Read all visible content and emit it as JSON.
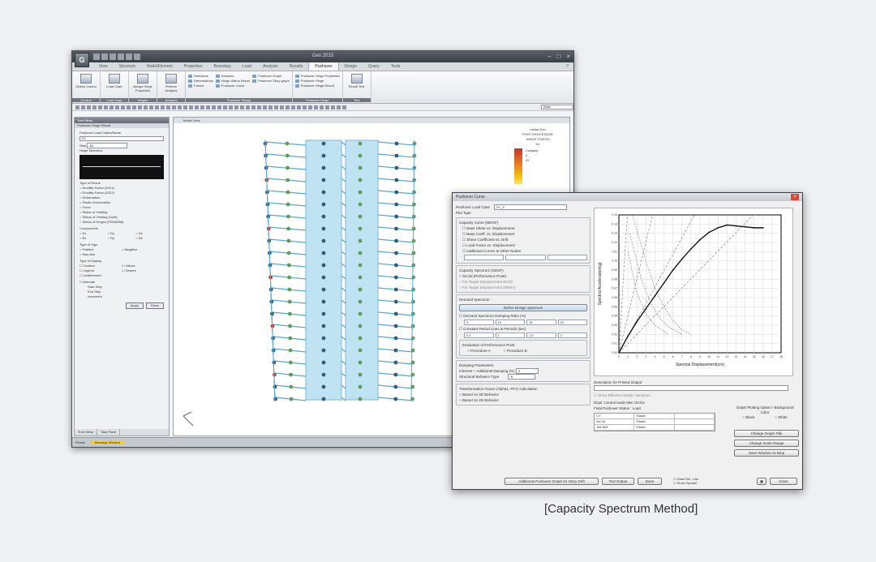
{
  "app": {
    "logo": "G",
    "title": "Gen 2015",
    "tabs": [
      "View",
      "Structure",
      "Node/Element",
      "Properties",
      "Boundary",
      "Load",
      "Analysis",
      "Results",
      "Pushover",
      "Design",
      "Query",
      "Tools"
    ],
    "active_tab": "Pushover",
    "ribbon": {
      "groups": [
        {
          "label": "Control",
          "buttons": [
            "Global Control"
          ]
        },
        {
          "label": "Load Case",
          "buttons": [
            "Load Case"
          ]
        },
        {
          "label": "Hinges",
          "buttons": [
            "Assign Hinge Properties"
          ]
        },
        {
          "label": "Analysis",
          "buttons": [
            "Perform Analysis"
          ]
        },
        {
          "label": "Pushover Result",
          "items": [
            "Reactions",
            "Deformations",
            "Forces",
            "Stresses",
            "Hinge Status Result",
            "Pushover Curve",
            "Pushover Graph",
            "Pushover Story graph"
          ]
        },
        {
          "label": "Pushover Hinge",
          "items": [
            "Pushover Hinge Properties",
            "Pushover Hinge",
            "Pushover Hinge Result"
          ]
        },
        {
          "label": "Text",
          "buttons": [
            "Result Text"
          ]
        }
      ]
    },
    "toolbar_search": "Base",
    "viewport_tab": "Model View",
    "legend": {
      "lines": [
        "midas Gen",
        "POST-PROCESSOR",
        "HINGE STATUS",
        "Dx"
      ],
      "items": [
        "Collapse",
        "0",
        "IO"
      ]
    },
    "status": {
      "left": "Ready",
      "message": "Message Window",
      "mid": "None",
      "units": "kN",
      "scale": "m"
    }
  },
  "tree_panel": {
    "title": "Tree Menu",
    "subtitle": "Pushover Hinge Result",
    "load_case_label": "Pushover Load Cases/Name",
    "load_case_value": "PL",
    "step_label": "Step",
    "step_value": "All",
    "hinge_label": "Hinge Members",
    "type_label": "Type of Result",
    "result_types": [
      "Ductility Factor (D/D1)",
      "Ductility Factor (D/D2)",
      "Deformation",
      "Plastic Deformation",
      "Force",
      "Status of Yielding",
      "Status of Yielding (Limit)",
      "Status of Hinges (FEMA356)"
    ],
    "components_label": "Components",
    "components": [
      "Dx",
      "Dy",
      "Dz",
      "Rx",
      "Ry",
      "Rz"
    ],
    "sign_label": "Type of Sign",
    "signs": [
      "Positive",
      "Negative",
      "Max Abs"
    ],
    "display_label": "Type of Display",
    "display_opts": [
      "Contour",
      "Values",
      "Legend",
      "Deform",
      "Undeformed"
    ],
    "anim_label": "Animate",
    "start_step": "Start Step",
    "end_step": "End Step",
    "increment": "Increment",
    "apply": "Apply",
    "close": "Close",
    "footer_tabs": [
      "Tree Menu",
      "Task Pane"
    ]
  },
  "dialog": {
    "title": "Pushover Curve",
    "load_case_label": "Pushover Load Case",
    "load_case_value": "PL_X",
    "plot_type": "Plot Type",
    "mdof_header": "Capacity Curve (MDOF)",
    "mdof_opts": [
      "Base Shear vs. Displacement",
      "Base Coeff. vs. Displacement",
      "Shear Coefficient vs. Drift",
      "Load Factor vs. Displacement",
      "Additional Curves at Other Nodes"
    ],
    "sdof_header": "Capacity Spectrum (SDOF)",
    "sdof_opts": [
      "Sa-Sd (Performance Point)",
      "For Target Displacement (EC8)",
      "For Target Displacement (FEMA)"
    ],
    "demand_header": "Demand Spectrum",
    "define_button": "Define Design Spectrum",
    "damping_label": "Demand Spectrum Damping Ratio (%)",
    "damping_values": [
      "5",
      "10",
      "15",
      "20"
    ],
    "period_label": "Constant Period Lines at Periods (sec)",
    "period_values": [
      "0.5",
      "1",
      "1.5",
      "2"
    ],
    "eval_label": "Evaluation of Performance Point",
    "eval_opts": [
      "Procedure A",
      "Procedure B"
    ],
    "damping_params": "Damping Parameters",
    "inherent_label": "Inherent + Additional Damping (%)",
    "inherent_value": "5",
    "structural_label": "Structural Behavior Type",
    "structural_value": "B",
    "transform_label": "Transformation Factor (Alpha1, PF1) Calculation",
    "transform_opts": [
      "Based on 3D Behavior",
      "Based on 2D Behavior"
    ],
    "plot_title": "",
    "desc_label": "Description for Printed Output",
    "perf_point_label": "Show Effective Elastic Spectrum",
    "graph_bg_label": "Graph Plotting Option / Background Color",
    "bg_opts": [
      "Black",
      "White"
    ],
    "ctrl_text": "Displ. Control Node 568, Dir:Dx",
    "ctrl_text2": "Final Pushover Status : Load",
    "table": [
      [
        "V,T",
        "Elastic"
      ],
      [
        "Sa,Sd",
        "Elastic"
      ],
      [
        "Teff,Beff",
        "Elastic"
      ]
    ],
    "side_buttons": [
      "Change Graph Title",
      "Change Scale Range",
      "Save Window As Bmp"
    ],
    "footer_buttons": [
      "Additional Pushover Graph for Story Drift",
      "Text Output",
      "Done",
      "Close"
    ],
    "footer_checks": [
      "Draw Ref. Line",
      "Show Symbol"
    ]
  },
  "chart_data": {
    "type": "line",
    "xlabel": "Spectral Displacement(cm)",
    "ylabel": "Spectral Acceleration(g)",
    "xlim": [
      0,
      18
    ],
    "ylim": [
      0,
      0.15
    ],
    "series": [
      {
        "id": "capacity",
        "x": [
          0,
          1,
          2,
          3,
          4,
          5,
          6,
          7,
          8,
          9,
          10,
          11,
          12,
          13,
          14,
          15,
          16
        ],
        "y": [
          0,
          0.018,
          0.034,
          0.048,
          0.062,
          0.076,
          0.09,
          0.102,
          0.113,
          0.123,
          0.131,
          0.136,
          0.139,
          0.138,
          0.137,
          0.136,
          0.136
        ]
      },
      {
        "id": "demand_5",
        "x": [
          1.5,
          3,
          4,
          5,
          6,
          7,
          8
        ],
        "y": [
          0.15,
          0.1,
          0.07,
          0.05,
          0.035,
          0.025,
          0.02
        ]
      },
      {
        "id": "demand_10",
        "x": [
          1.2,
          2.5,
          3.5,
          4.5,
          5.5,
          7
        ],
        "y": [
          0.13,
          0.08,
          0.055,
          0.038,
          0.028,
          0.02
        ]
      },
      {
        "id": "demand_15",
        "x": [
          1.0,
          2.0,
          3.0,
          4.0,
          5.5
        ],
        "y": [
          0.11,
          0.065,
          0.042,
          0.03,
          0.02
        ]
      }
    ],
    "period_lines": [
      0.5,
      1,
      1.5,
      2
    ],
    "grid": true
  },
  "caption": "[Capacity Spectrum Method]"
}
